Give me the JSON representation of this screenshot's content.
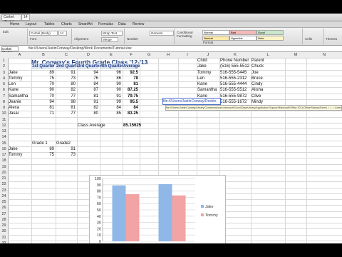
{
  "toolbar": {
    "font_name": "Corbel (Body)",
    "font_size": "14",
    "buttons": [
      "Home",
      "Layout",
      "Tables",
      "Charts",
      "SmartArt",
      "Formulas",
      "Data",
      "Review"
    ]
  },
  "ribbon": {
    "font_box": "Corbel (Body)",
    "font_size": "14",
    "wrap_label": "Wrap Text",
    "number_format": "General",
    "merge_label": "Merge",
    "conditional_label": "Conditional Formatting",
    "styles": [
      {
        "label": "Normal",
        "bg": "#ffffff"
      },
      {
        "label": "Bad",
        "bg": "#f4b8b8"
      },
      {
        "label": "Good",
        "bg": "#c8e6c9"
      },
      {
        "label": "Neutral",
        "bg": "#fde9a9"
      },
      {
        "label": "Hyperlink",
        "bg": "#ffffff"
      },
      {
        "label": "Note",
        "bg": "#fdf5c8"
      },
      {
        "label": "Explanatory",
        "bg": "#ffffff"
      },
      {
        "label": "Output",
        "bg": "#e8e8e8"
      }
    ],
    "groups": [
      "Edit",
      "Font",
      "Alignment",
      "Number",
      "Format",
      "Cells",
      "Themes"
    ]
  },
  "formula_bar": {
    "name_box": "Corbel (Body)",
    "formula": "file:///Users/JustinConway/Desktop/Work Documents/Tutorial.xlsx"
  },
  "columns": [
    "A",
    "B",
    "C",
    "D",
    "E",
    "F",
    "G",
    "H",
    "I",
    "J",
    "K",
    "L",
    "M",
    "N"
  ],
  "rows": [
    "1",
    "2",
    "3",
    "4",
    "5",
    "6",
    "7",
    "8",
    "9",
    "10",
    "11",
    "12",
    "13",
    "14",
    "15",
    "16",
    "17",
    "18",
    "19",
    "20",
    "21",
    "22",
    "23",
    "24",
    "25",
    "26",
    "27",
    "28",
    "29",
    "30",
    "31",
    "32"
  ],
  "sheet": {
    "title": "Mr. Conway's Fourth Grade Class '12-'13",
    "quarter_headers": [
      "1st Quarter",
      "2nd Quarter",
      "3rd Quarter",
      "4th Quarter",
      "Average"
    ],
    "students": [
      {
        "name": "Jake",
        "q1": "89",
        "q2": "91",
        "q3": "94",
        "q4": "96",
        "avg": "92.5"
      },
      {
        "name": "Tommy",
        "q1": "75",
        "q2": "73",
        "q3": "76",
        "q4": "86",
        "avg": "78"
      },
      {
        "name": "Len",
        "q1": "70",
        "q2": "80",
        "q3": "84",
        "q4": "90",
        "avg": "81"
      },
      {
        "name": "Kane",
        "q1": "90",
        "q2": "82",
        "q3": "87",
        "q4": "90",
        "avg": "87.25"
      },
      {
        "name": "Samantha",
        "q1": "70",
        "q2": "77",
        "q3": "81",
        "q4": "91",
        "avg": "79.75"
      },
      {
        "name": "Jeanie",
        "q1": "94",
        "q2": "98",
        "q3": "91",
        "q4": "99",
        "avg": "95.5"
      },
      {
        "name": "Alexa",
        "q1": "81",
        "q2": "81",
        "q3": "82",
        "q4": "84",
        "avg": "84"
      },
      {
        "name": "Jasai",
        "q1": "71",
        "q2": "77",
        "q3": "80",
        "q4": "85",
        "avg": "83.25"
      }
    ],
    "class_average_label": "Class Average",
    "class_average_value": "85.15625",
    "path_cell": "file:///Users/JustinConway/Deskto",
    "tooltip": "file:///Users/JustinConway/Library/Containers/com.microsoft.Excel/Data/Library/Application Support/Microsoft/Office 2011/Office/Startup/Excel/../../../../Users/JustinConway/Desktop/Work Documents/Tutorial.xlsx",
    "grade_headers": [
      "Grade 1",
      "Grade2"
    ],
    "grade_rows": [
      {
        "name": "Jake",
        "g1": "89",
        "g2": "91"
      },
      {
        "name": "Tommy",
        "g1": "75",
        "g2": "73"
      }
    ],
    "contacts_headers": [
      "Child",
      "Phone Number",
      "Parent"
    ],
    "contacts": [
      {
        "child": "Jake",
        "phone": "(516) 555-5512",
        "parent": "Chuck"
      },
      {
        "child": "Tommy",
        "phone": "516-555-5445",
        "parent": "Joe"
      },
      {
        "child": "Len",
        "phone": "516-555-2312",
        "parent": "Bruce"
      },
      {
        "child": "Kane",
        "phone": "516-555-4444",
        "parent": "Cindy"
      },
      {
        "child": "Samantha",
        "phone": "516-555-5512",
        "parent": "Alisha"
      },
      {
        "child": "Kane",
        "phone": "516-555-9872",
        "parent": "Clive"
      },
      {
        "child": "Alexa",
        "phone": "516-555-1672",
        "parent": "Mindy"
      },
      {
        "child": "Jasai",
        "phone": "516-555-0000",
        "parent": "Charles"
      }
    ]
  },
  "chart_data": {
    "type": "bar",
    "categories": [
      "Grade 1",
      "Grade2"
    ],
    "series": [
      {
        "name": "Jake",
        "values": [
          89,
          91
        ],
        "color": "#8fb8e8"
      },
      {
        "name": "Tommy",
        "values": [
          75,
          73
        ],
        "color": "#f2a3a3"
      }
    ],
    "ylim": [
      0,
      100
    ],
    "yticks": [
      "0",
      "10",
      "20",
      "30",
      "40",
      "50",
      "60",
      "70",
      "80",
      "90",
      "100"
    ],
    "grid": true,
    "legend": "right"
  }
}
